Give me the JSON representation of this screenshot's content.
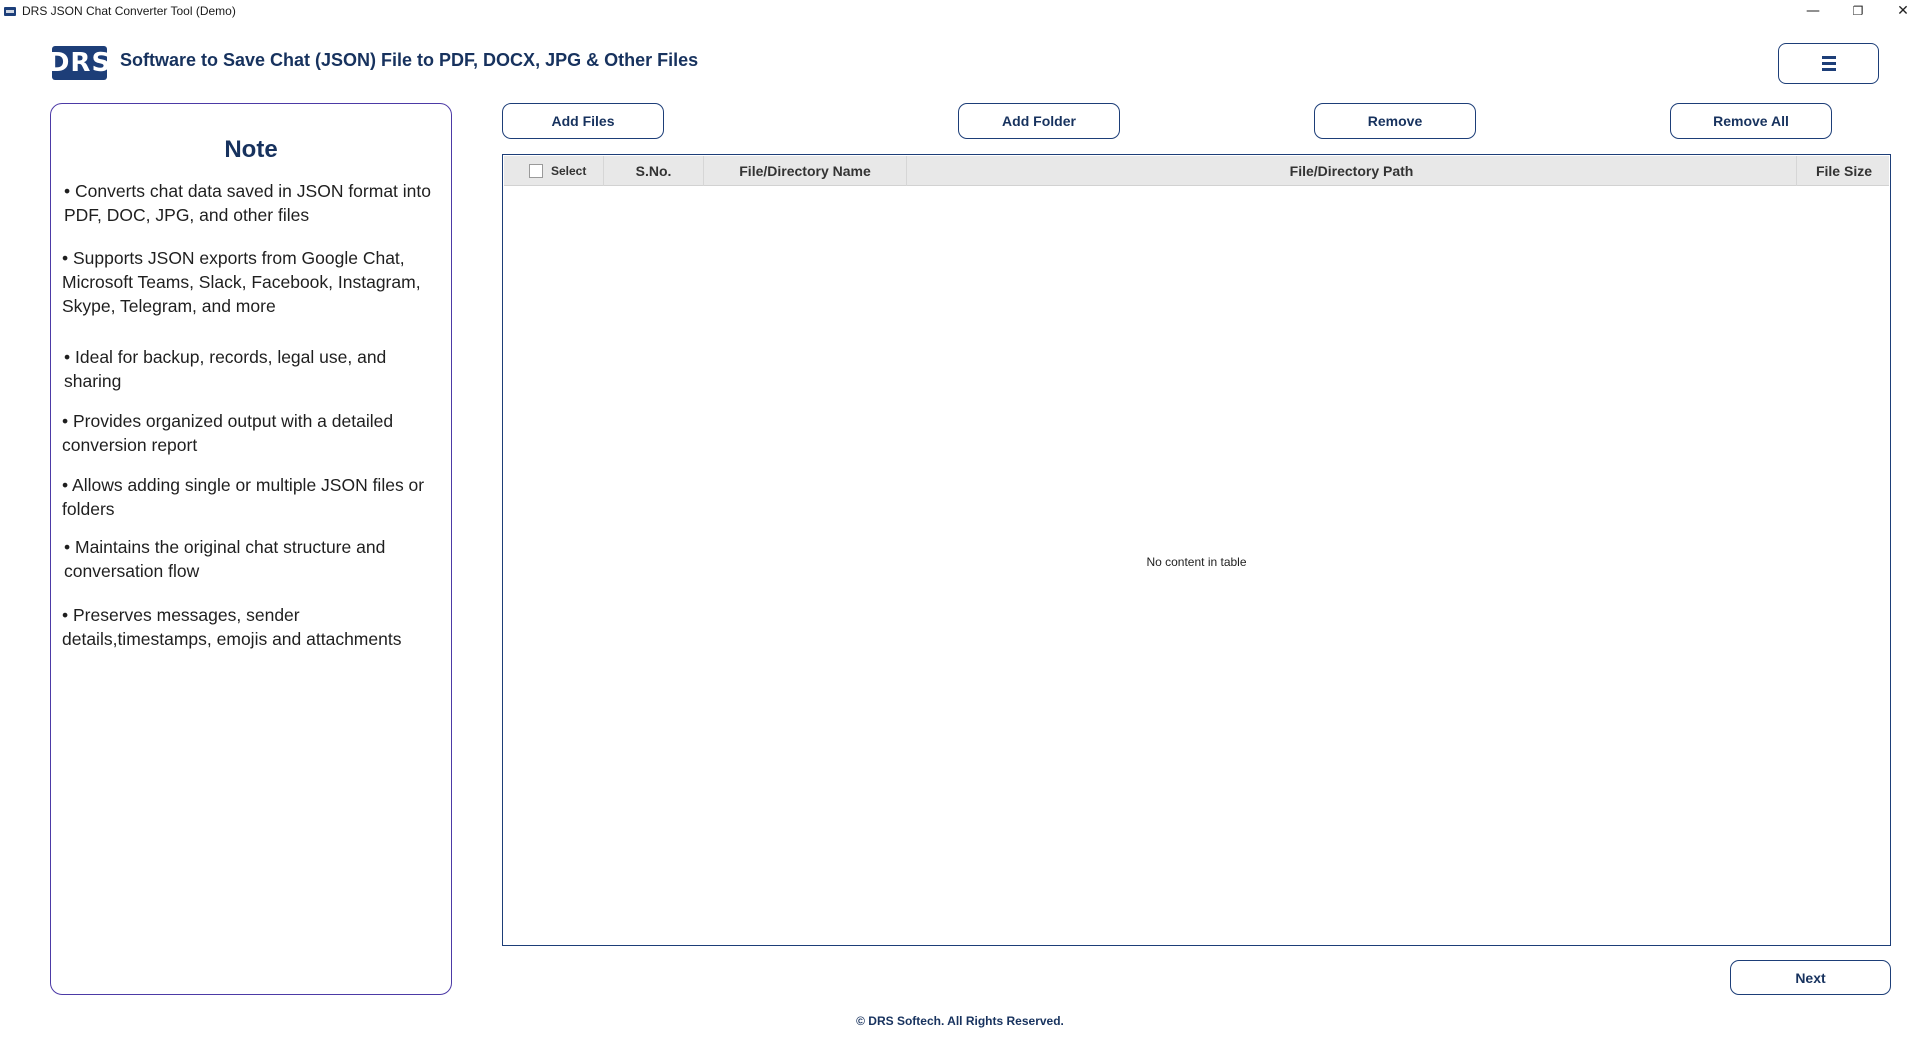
{
  "window": {
    "title": "DRS JSON Chat Converter Tool (Demo)",
    "minimize_glyph": "—",
    "maximize_glyph": "❐",
    "close_glyph": "✕"
  },
  "header": {
    "logo_text": "DRS",
    "title": "Software to Save Chat (JSON) File to PDF, DOCX, JPG & Other Files"
  },
  "note": {
    "title": "Note",
    "items": [
      " • Converts chat data saved in JSON format into  PDF, DOC, JPG, and other files",
      "• Supports JSON exports from Google Chat, Microsoft Teams, Slack, Facebook, Instagram, Skype, Telegram, and more",
      " • Ideal for backup, records, legal use, and sharing",
      "• Provides organized output with a detailed conversion report",
      "• Allows adding single or multiple JSON files or folders",
      " • Maintains the original chat structure and conversation flow",
      "• Preserves messages, sender details,timestamps, emojis and attachments"
    ]
  },
  "actions": {
    "add_files": "Add Files",
    "add_folder": "Add Folder",
    "remove": "Remove",
    "remove_all": "Remove All"
  },
  "table": {
    "columns": {
      "select": "Select",
      "sno": "S.No.",
      "name": "File/Directory Name",
      "path": "File/Directory Path",
      "size": "File Size"
    },
    "rows": [],
    "empty_message": "No content in table"
  },
  "next_label": "Next",
  "footer": "© DRS Softech. All Rights Reserved.",
  "colors": {
    "brand": "#1d3e78",
    "note_border": "#4c3aa6"
  },
  "icons": {
    "menu": "hamburger-icon",
    "app": "app-icon"
  }
}
